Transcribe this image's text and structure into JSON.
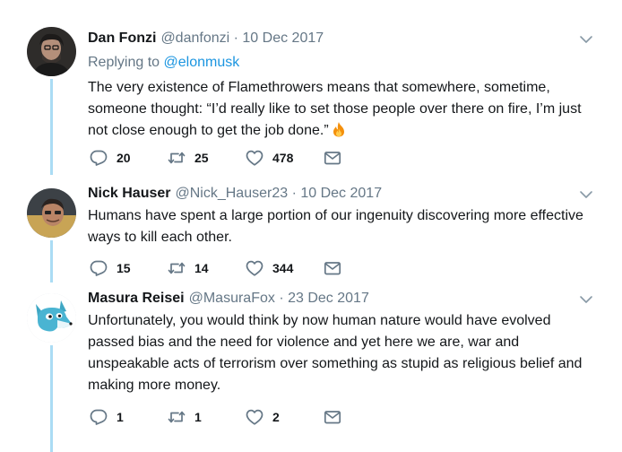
{
  "tweets": [
    {
      "name": "Dan Fonzi",
      "handle": "@danfonzi",
      "separator": "·",
      "date": "10 Dec 2017",
      "replying_prefix": "Replying to",
      "replying_to": "@elonmusk",
      "text": "The very existence of Flamethrowers means that somewhere, sometime, someone thought: “I’d really like to set those people over there on fire, I’m just not close enough to get the job done.”",
      "emoji": "fire-icon",
      "replies": "20",
      "retweets": "25",
      "likes": "478"
    },
    {
      "name": "Nick Hauser",
      "handle": "@Nick_Hauser23",
      "separator": "·",
      "date": "10 Dec 2017",
      "text": "Humans have spent a large portion of our ingenuity discovering more effective ways to kill each other.",
      "replies": "15",
      "retweets": "14",
      "likes": "344"
    },
    {
      "name": "Masura Reisei",
      "handle": "@MasuraFox",
      "separator": "·",
      "date": "23 Dec 2017",
      "text": "Unfortunately, you would think by now human nature would have evolved passed bias and the need for violence and yet here we are, war and unspeakable acts of terrorism over something as stupid as religious belief and making more money.",
      "replies": "1",
      "retweets": "1",
      "likes": "2"
    }
  ],
  "colors": {
    "thread_line": "#abdcf4",
    "link": "#1b95e0",
    "muted": "#657786",
    "text": "#14171a"
  },
  "icons": [
    "reply-icon",
    "retweet-icon",
    "like-icon",
    "message-icon",
    "chevron-down-icon"
  ]
}
